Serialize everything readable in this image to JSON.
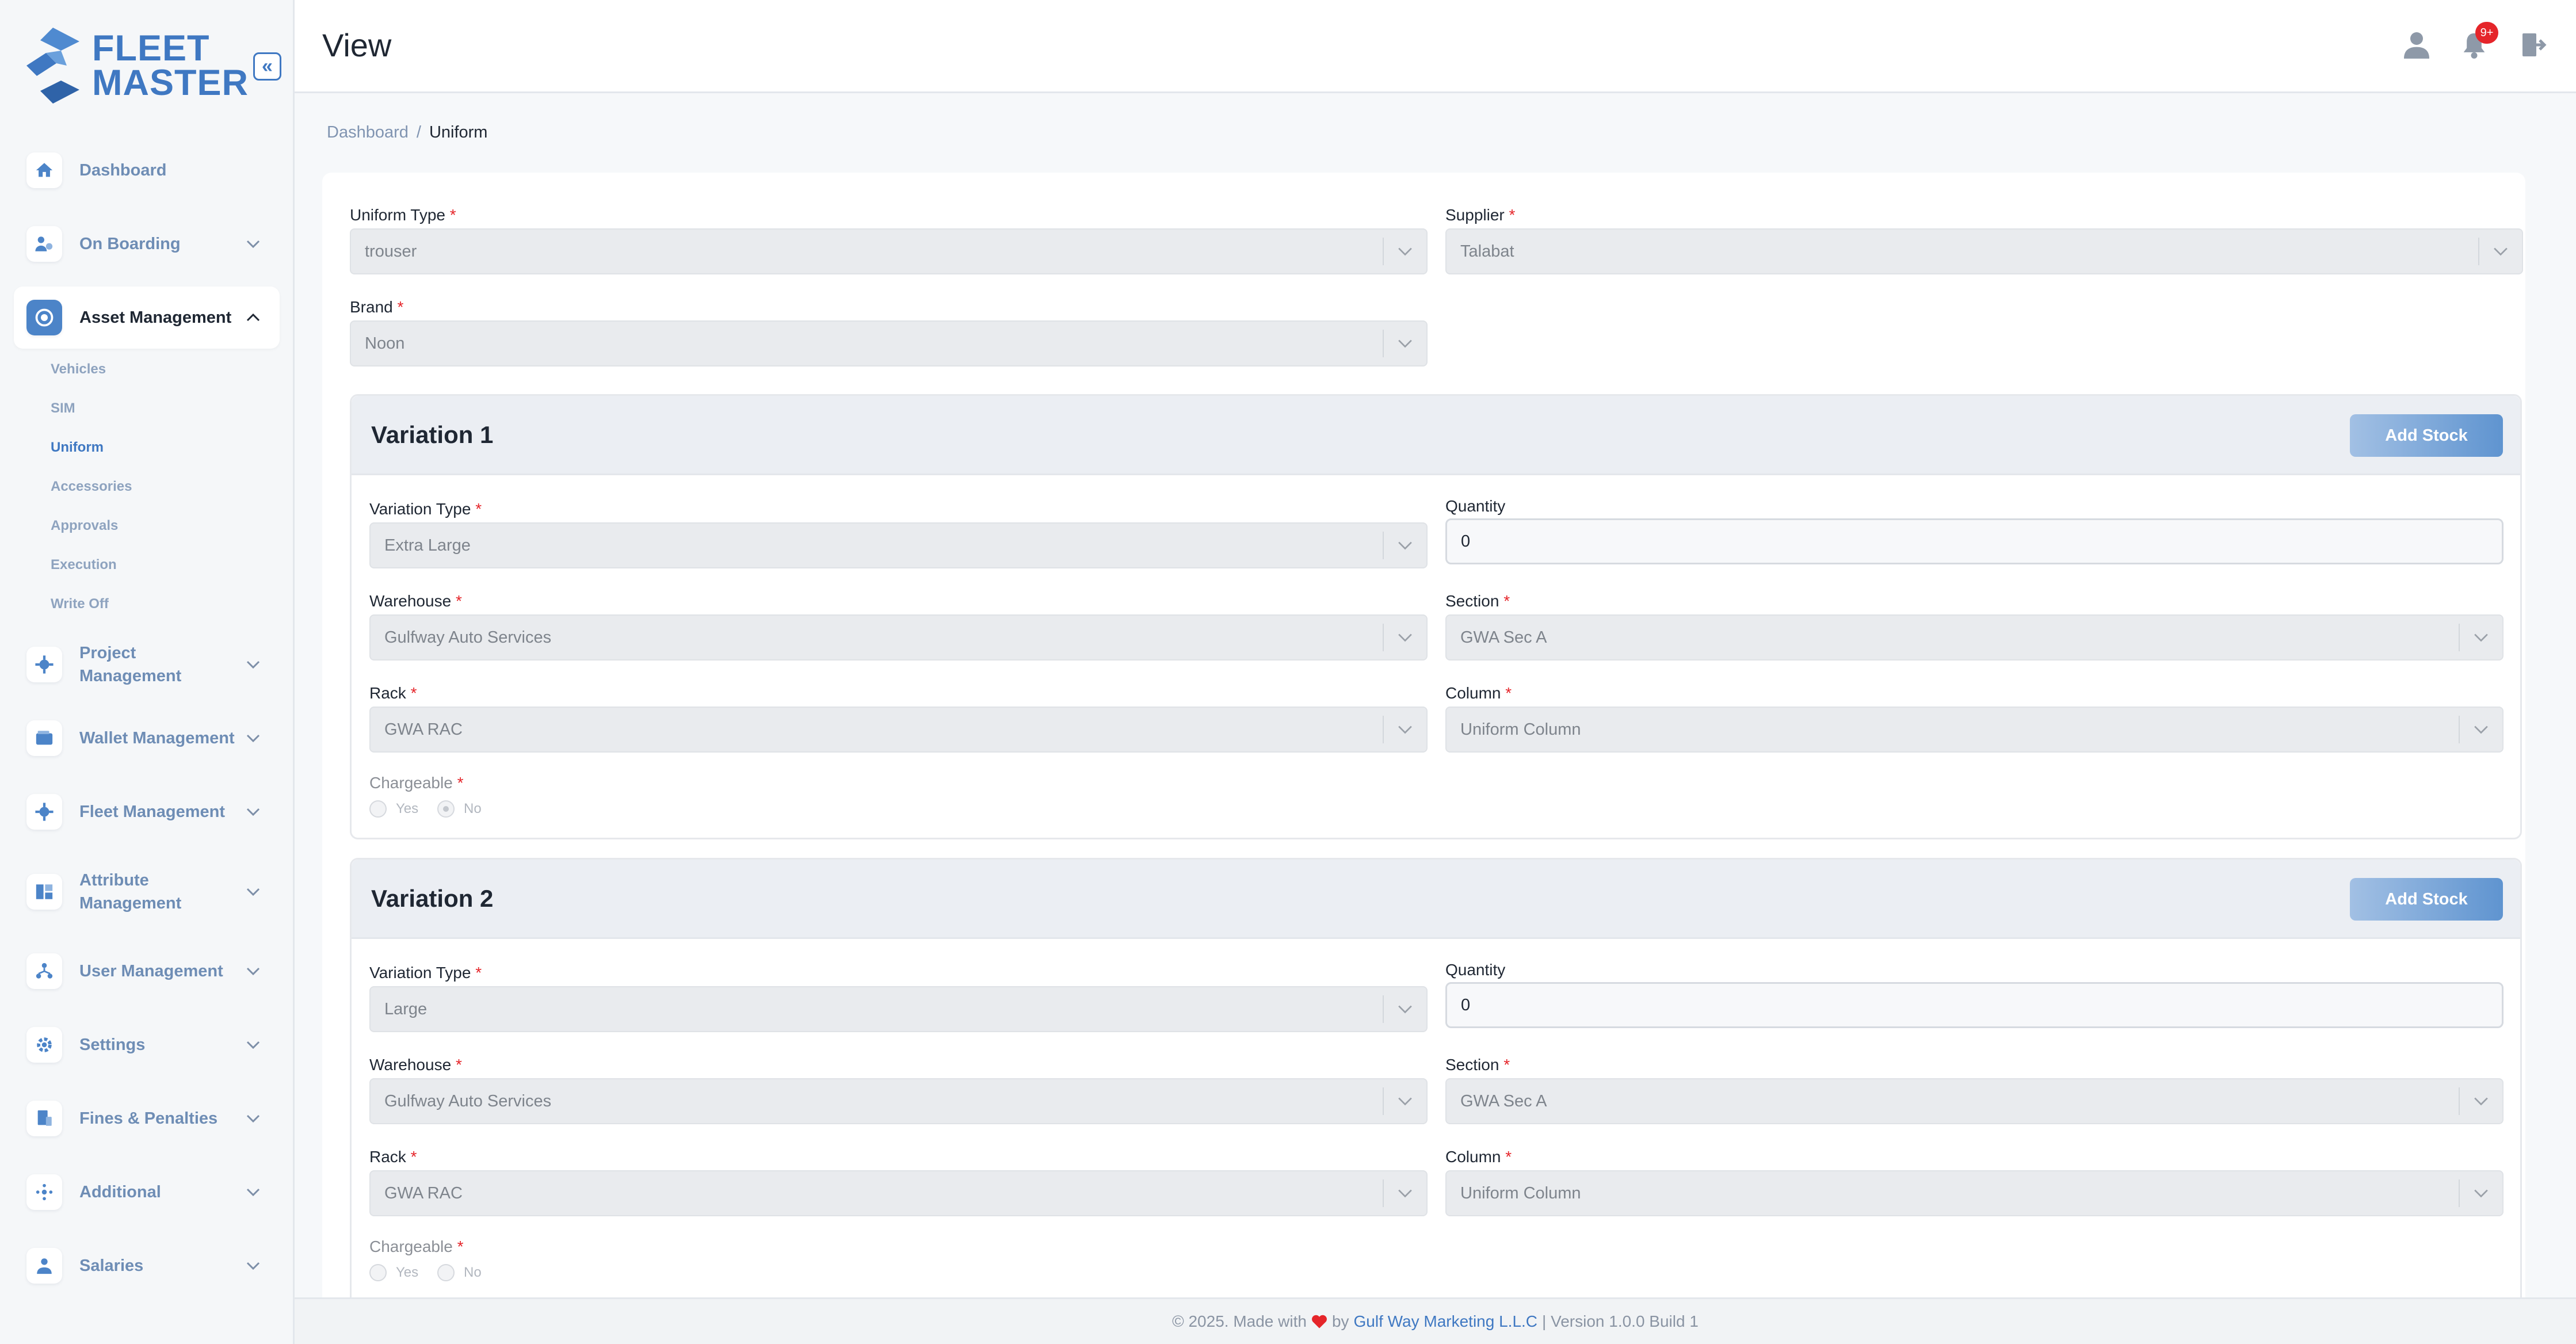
{
  "app": {
    "logo_line1": "FLEET",
    "logo_line2": "MASTER",
    "brand_color": "#3f78c2"
  },
  "header": {
    "title": "View",
    "notification_count": "9+"
  },
  "breadcrumb": {
    "root": "Dashboard",
    "separator": "/",
    "current": "Uniform"
  },
  "sidebar": {
    "items": [
      {
        "label": "Dashboard",
        "icon": "home-icon"
      },
      {
        "label": "On Boarding",
        "icon": "people-icon"
      },
      {
        "label": "Asset Management",
        "icon": "asset-icon"
      },
      {
        "label": "Project Management",
        "icon": "project-icon"
      },
      {
        "label": "Wallet Management",
        "icon": "wallet-icon"
      },
      {
        "label": "Fleet Management",
        "icon": "fleet-icon"
      },
      {
        "label": "Attribute",
        "label2": "Management",
        "icon": "attribute-icon"
      },
      {
        "label": "User Management",
        "icon": "user-management-icon"
      },
      {
        "label": "Settings",
        "icon": "gear-icon"
      },
      {
        "label": "Fines & Penalties",
        "icon": "fines-icon"
      },
      {
        "label": "Additional",
        "icon": "additional-icon"
      },
      {
        "label": "Salaries",
        "icon": "salaries-icon"
      }
    ],
    "sub_items": [
      "Vehicles",
      "SIM",
      "Uniform",
      "Accessories",
      "Approvals",
      "Execution",
      "Write Off"
    ]
  },
  "form": {
    "uniform_type": {
      "label": "Uniform Type",
      "value": "trouser"
    },
    "supplier": {
      "label": "Supplier",
      "value": "Talabat"
    },
    "brand": {
      "label": "Brand",
      "value": "Noon"
    }
  },
  "variations": [
    {
      "title": "Variation 1",
      "button": "Add Stock",
      "variation_type": {
        "label": "Variation Type",
        "value": "Extra Large"
      },
      "quantity": {
        "label": "Quantity",
        "value": "0"
      },
      "warehouse": {
        "label": "Warehouse",
        "value": "Gulfway Auto Services"
      },
      "section": {
        "label": "Section",
        "value": "GWA Sec A"
      },
      "rack": {
        "label": "Rack",
        "value": "GWA RAC"
      },
      "column": {
        "label": "Column",
        "value": "Uniform Column"
      },
      "chargeable": {
        "label": "Chargeable",
        "yes": "Yes",
        "no": "No",
        "selected": "No"
      }
    },
    {
      "title": "Variation 2",
      "button": "Add Stock",
      "variation_type": {
        "label": "Variation Type",
        "value": "Large"
      },
      "quantity": {
        "label": "Quantity",
        "value": "0"
      },
      "warehouse": {
        "label": "Warehouse",
        "value": "Gulfway Auto Services"
      },
      "section": {
        "label": "Section",
        "value": "GWA Sec A"
      },
      "rack": {
        "label": "Rack",
        "value": "GWA RAC"
      },
      "column": {
        "label": "Column",
        "value": "Uniform Column"
      },
      "chargeable": {
        "label": "Chargeable",
        "yes": "Yes",
        "no": "No",
        "selected": "none"
      }
    }
  ],
  "footer": {
    "prefix": "© 2025. Made with",
    "by": "by",
    "company": "Gulf Way Marketing L.L.C",
    "suffix": "| Version 1.0.0 Build 1"
  }
}
